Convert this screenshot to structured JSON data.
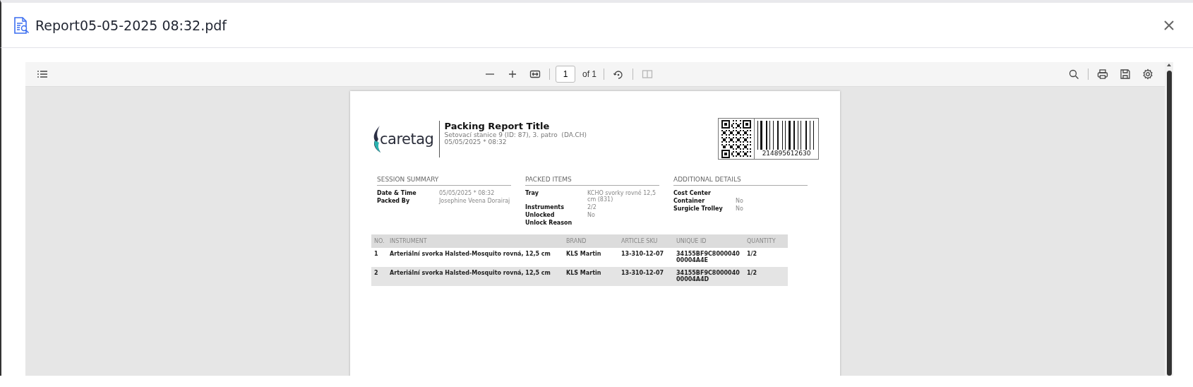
{
  "dialog": {
    "title": "Report05-05-2025 08:32.pdf"
  },
  "toolbar": {
    "page_number": "1",
    "page_count": "of 1",
    "two_page_disabled": true
  },
  "report": {
    "logo_text": "caretag",
    "title": "Packing Report Title",
    "location": "Setovací stanice 9 (ID: 87), 3. patro  (DA.CH)",
    "datetime": "05/05/2025 * 08:32",
    "barcode_number": "214895612630",
    "sections": [
      {
        "heading": "SESSION SUMMARY",
        "fields": [
          {
            "label": "Date & Time",
            "value": "05/05/2025 * 08:32"
          },
          {
            "label": "Packed By",
            "value": "Josephine Veena Dorairaj"
          }
        ]
      },
      {
        "heading": "PACKED ITEMS",
        "fields": [
          {
            "label": "Tray",
            "value": "KCHO svorky rovné 12,5 cm (831)"
          },
          {
            "label": "Instruments",
            "value": "2/2"
          },
          {
            "label": "Unlocked",
            "value": "No"
          },
          {
            "label": "Unlock Reason"
          }
        ]
      },
      {
        "heading": "ADDITIONAL DETAILS",
        "fields": [
          {
            "label": "Cost Center"
          },
          {
            "label": "Container",
            "value": "No"
          },
          {
            "label": "Surgicle Trolley",
            "value": "No"
          }
        ]
      }
    ],
    "table": {
      "columns": [
        "NO.",
        "INSTRUMENT",
        "BRAND",
        "ARTICLE SKU",
        "UNIQUE ID",
        "QUANTITY"
      ],
      "rows": [
        [
          "1",
          "Arteriální svorka Halsted-Mosquito rovná, 12,5 cm",
          "KLS Martin",
          "13-310-12-07",
          "34155BF9C800004000004A4E",
          "1/2"
        ],
        [
          "2",
          "Arteriální svorka Halsted-Mosquito rovná, 12,5 cm",
          "KLS Martin",
          "13-310-12-07",
          "34155BF9C800004000004A4D",
          "1/2"
        ]
      ]
    }
  }
}
